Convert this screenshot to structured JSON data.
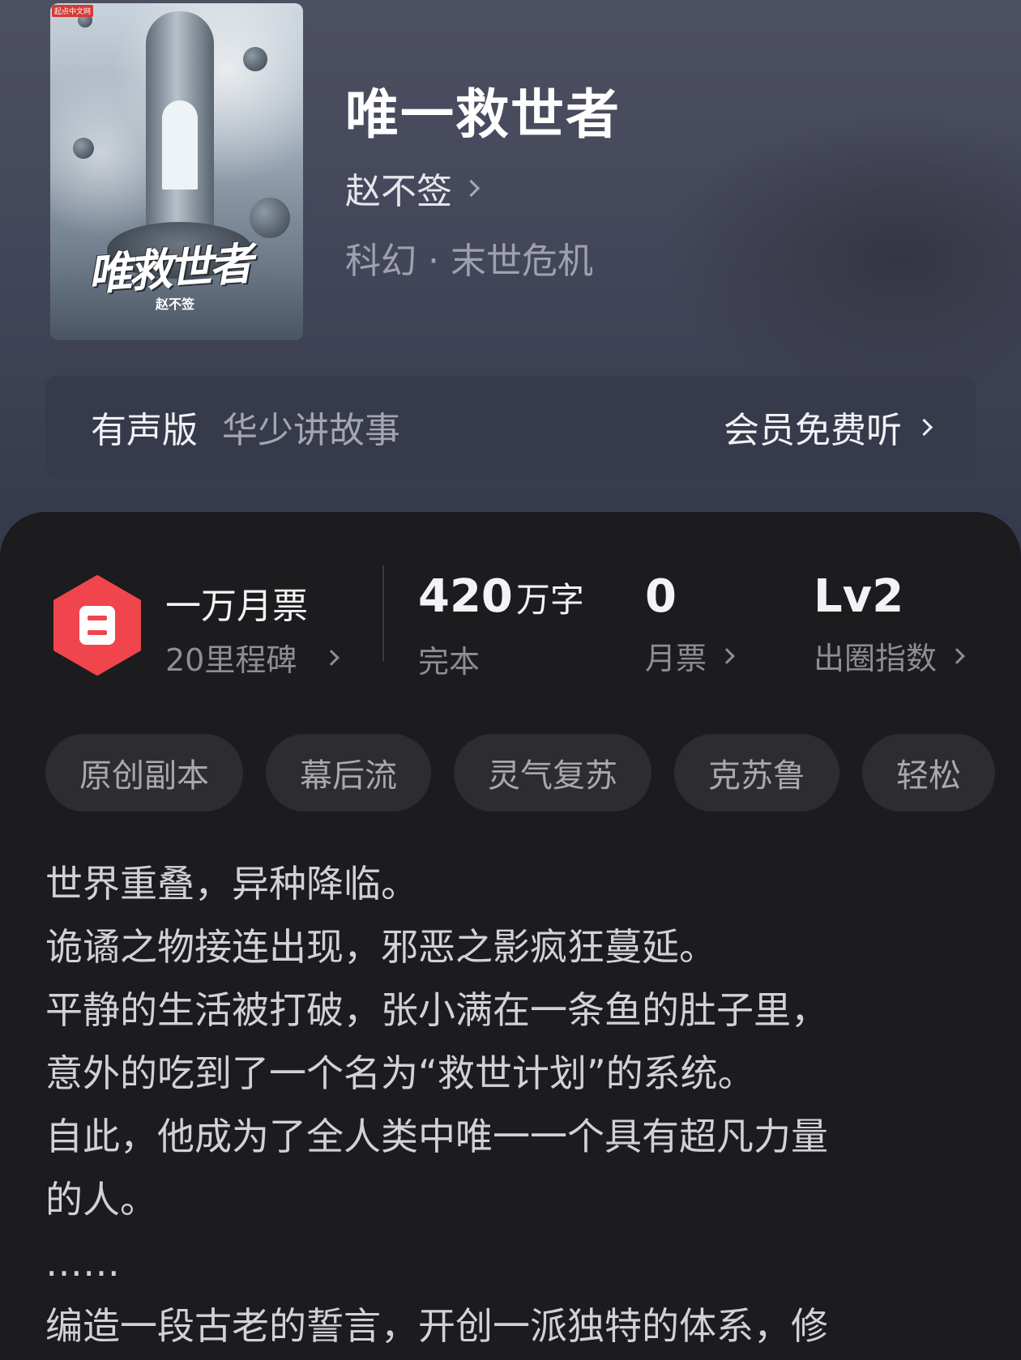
{
  "book": {
    "title": "唯一救世者",
    "author": "赵不签",
    "genre": "科幻 · 末世危机",
    "cover": {
      "title_text": "唯救世者",
      "author_text": "赵不签",
      "publisher_badge": "起点中文网"
    }
  },
  "audio": {
    "label": "有声版",
    "narrator": "华少讲故事",
    "cta": "会员免费听"
  },
  "stats": {
    "ticket": {
      "title": "一万月票",
      "subtitle": "20里程碑"
    },
    "words": {
      "value": "420",
      "unit": "万字",
      "label": "完本"
    },
    "monthly": {
      "value": "0",
      "label": "月票"
    },
    "level": {
      "value": "Lv2",
      "label": "出圈指数"
    }
  },
  "tags": [
    "原创副本",
    "幕后流",
    "灵气复苏",
    "克苏鲁",
    "轻松"
  ],
  "synopsis": [
    "世界重叠，异种降临。",
    "诡谲之物接连出现，邪恶之影疯狂蔓延。",
    "平静的生活被打破，张小满在一条鱼的肚子里，",
    "意外的吃到了一个名为“救世计划”的系统。",
    "自此，他成为了全人类中唯一一个具有超凡力量",
    "的人。",
    "……",
    "编造一段古老的誓言，开创一派独特的体系，修"
  ],
  "colors": {
    "header_bg": "#45485b",
    "panel_bg": "#1c1c1e",
    "ticket_icon": "#f0454c",
    "tag_bg": "#2d2d30"
  },
  "icons": [
    "chevron-right-icon",
    "ticket-icon"
  ]
}
